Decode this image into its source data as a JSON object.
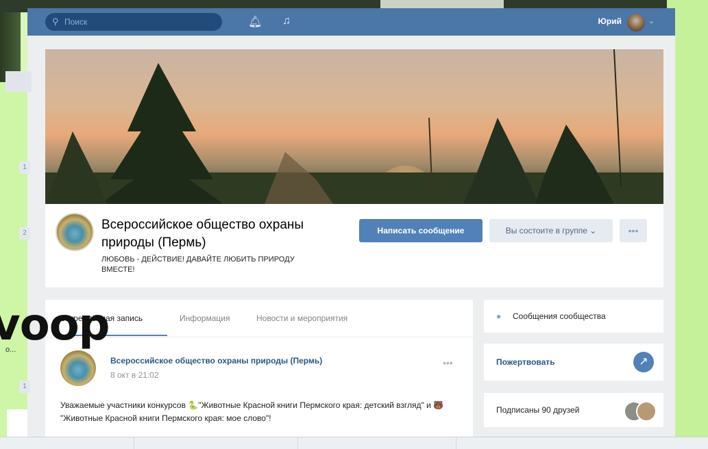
{
  "header": {
    "search_placeholder": "Поиск",
    "search_icon": "search-icon",
    "bell_icon": "bell-icon",
    "music_icon": "music-icon",
    "user_name": "Юрий",
    "caret": "⌄"
  },
  "left_counters": [
    "1",
    "2",
    "1"
  ],
  "group": {
    "title": "Всероссийское общество охраны природы (Пермь)",
    "status": "ЛЮБОВЬ - ДЕЙСТВИЕ! ДАВАЙТЕ ЛЮБИТЬ ПРИРОДУ ВМЕСТЕ!",
    "send_message_label": "Написать сообщение",
    "membership_label": "Вы состоите в группе ⌄",
    "more_label": "•••"
  },
  "wall": {
    "tabs": [
      {
        "label": "Закреплённая запись"
      },
      {
        "label": "Информация"
      },
      {
        "label": "Новости и мероприятия"
      }
    ],
    "post": {
      "author": "Всероссийское общество охраны природы (Пермь)",
      "date": "8 окт в 21:02",
      "more": "•••",
      "text": "Уважаемые участники конкурсов 🐍\"Животные Красной книги Пермского края: детский взгляд\" и 🐻 \"Животные Красной книги Пермского края: мое слово\"!"
    }
  },
  "sidebar": {
    "messages_label": "Сообщения сообщества",
    "donate_label": "Пожертвовать",
    "donate_icon": "↗",
    "friends_label": "Подписаны 90 друзей"
  },
  "overlay": {
    "big_text": "voop",
    "small_text": "о..."
  },
  "colors": {
    "header_blue": "#4a76a8",
    "button_blue": "#5181b8",
    "link_blue": "#2a5885",
    "page_bg": "#edeef0"
  }
}
